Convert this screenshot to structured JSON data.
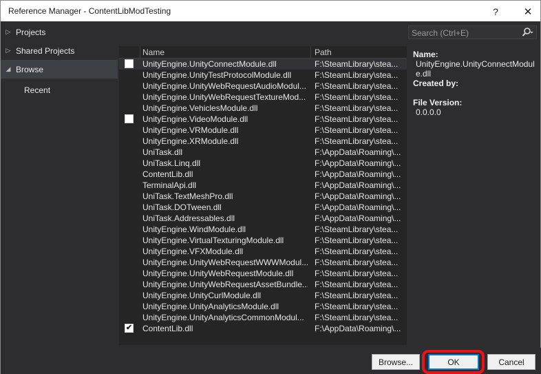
{
  "window": {
    "title": "Reference Manager - ContentLibModTesting",
    "help_glyph": "?",
    "close_glyph": "✕"
  },
  "sidebar": {
    "items": [
      {
        "label": "Projects",
        "arrow": "▷"
      },
      {
        "label": "Shared Projects",
        "arrow": "▷"
      },
      {
        "label": "Browse",
        "arrow": "◢"
      },
      {
        "label": "Recent",
        "arrow": ""
      }
    ]
  },
  "search": {
    "placeholder": "Search (Ctrl+E)",
    "icon": "search-icon"
  },
  "list": {
    "columns": [
      "Name",
      "Path"
    ],
    "rows": [
      {
        "checked": false,
        "checkbox": true,
        "name": "UnityEngine.UnityConnectModule.dll",
        "path": "F:\\SteamLibrary\\stea..."
      },
      {
        "checked": false,
        "checkbox": false,
        "name": "UnityEngine.UnityTestProtocolModule.dll",
        "path": "F:\\SteamLibrary\\stea..."
      },
      {
        "checked": false,
        "checkbox": false,
        "name": "UnityEngine.UnityWebRequestAudioModul...",
        "path": "F:\\SteamLibrary\\stea..."
      },
      {
        "checked": false,
        "checkbox": false,
        "name": "UnityEngine.UnityWebRequestTextureMod...",
        "path": "F:\\SteamLibrary\\stea..."
      },
      {
        "checked": false,
        "checkbox": false,
        "name": "UnityEngine.VehiclesModule.dll",
        "path": "F:\\SteamLibrary\\stea..."
      },
      {
        "checked": false,
        "checkbox": true,
        "name": "UnityEngine.VideoModule.dll",
        "path": "F:\\SteamLibrary\\stea..."
      },
      {
        "checked": false,
        "checkbox": false,
        "name": "UnityEngine.VRModule.dll",
        "path": "F:\\SteamLibrary\\stea..."
      },
      {
        "checked": false,
        "checkbox": false,
        "name": "UnityEngine.XRModule.dll",
        "path": "F:\\SteamLibrary\\stea..."
      },
      {
        "checked": false,
        "checkbox": false,
        "name": "UniTask.dll",
        "path": "F:\\AppData\\Roaming\\..."
      },
      {
        "checked": false,
        "checkbox": false,
        "name": "UniTask.Linq.dll",
        "path": "F:\\AppData\\Roaming\\..."
      },
      {
        "checked": false,
        "checkbox": false,
        "name": "ContentLib.dll",
        "path": "F:\\AppData\\Roaming\\..."
      },
      {
        "checked": false,
        "checkbox": false,
        "name": "TerminalApi.dll",
        "path": "F:\\AppData\\Roaming\\..."
      },
      {
        "checked": false,
        "checkbox": false,
        "name": "UniTask.TextMeshPro.dll",
        "path": "F:\\AppData\\Roaming\\..."
      },
      {
        "checked": false,
        "checkbox": false,
        "name": "UniTask.DOTween.dll",
        "path": "F:\\AppData\\Roaming\\..."
      },
      {
        "checked": false,
        "checkbox": false,
        "name": "UniTask.Addressables.dll",
        "path": "F:\\AppData\\Roaming\\..."
      },
      {
        "checked": false,
        "checkbox": false,
        "name": "UnityEngine.WindModule.dll",
        "path": "F:\\SteamLibrary\\stea..."
      },
      {
        "checked": false,
        "checkbox": false,
        "name": "UnityEngine.VirtualTexturingModule.dll",
        "path": "F:\\SteamLibrary\\stea..."
      },
      {
        "checked": false,
        "checkbox": false,
        "name": "UnityEngine.VFXModule.dll",
        "path": "F:\\SteamLibrary\\stea..."
      },
      {
        "checked": false,
        "checkbox": false,
        "name": "UnityEngine.UnityWebRequestWWWModul...",
        "path": "F:\\SteamLibrary\\stea..."
      },
      {
        "checked": false,
        "checkbox": false,
        "name": "UnityEngine.UnityWebRequestModule.dll",
        "path": "F:\\SteamLibrary\\stea..."
      },
      {
        "checked": false,
        "checkbox": false,
        "name": "UnityEngine.UnityWebRequestAssetBundle...",
        "path": "F:\\SteamLibrary\\stea..."
      },
      {
        "checked": false,
        "checkbox": false,
        "name": "UnityEngine.UnityCurlModule.dll",
        "path": "F:\\SteamLibrary\\stea..."
      },
      {
        "checked": false,
        "checkbox": false,
        "name": "UnityEngine.UnityAnalyticsModule.dll",
        "path": "F:\\SteamLibrary\\stea..."
      },
      {
        "checked": false,
        "checkbox": false,
        "name": "UnityEngine.UnityAnalyticsCommonModul...",
        "path": "F:\\SteamLibrary\\stea..."
      },
      {
        "checked": true,
        "checkbox": true,
        "name": "ContentLib.dll",
        "path": "F:\\AppData\\Roaming\\..."
      }
    ]
  },
  "details": {
    "name_label": "Name:",
    "name_value": "UnityEngine.UnityConnectModule.dll",
    "created_label": "Created by:",
    "version_label": "File Version:",
    "version_value": "0.0.0.0"
  },
  "footer": {
    "browse_label": "Browse...",
    "ok_label": "OK",
    "cancel_label": "Cancel"
  },
  "colors": {
    "background": "#2d2d30",
    "list_background": "#252526",
    "highlight_ring": "#e8141a",
    "default_button_border": "#0078d7"
  }
}
